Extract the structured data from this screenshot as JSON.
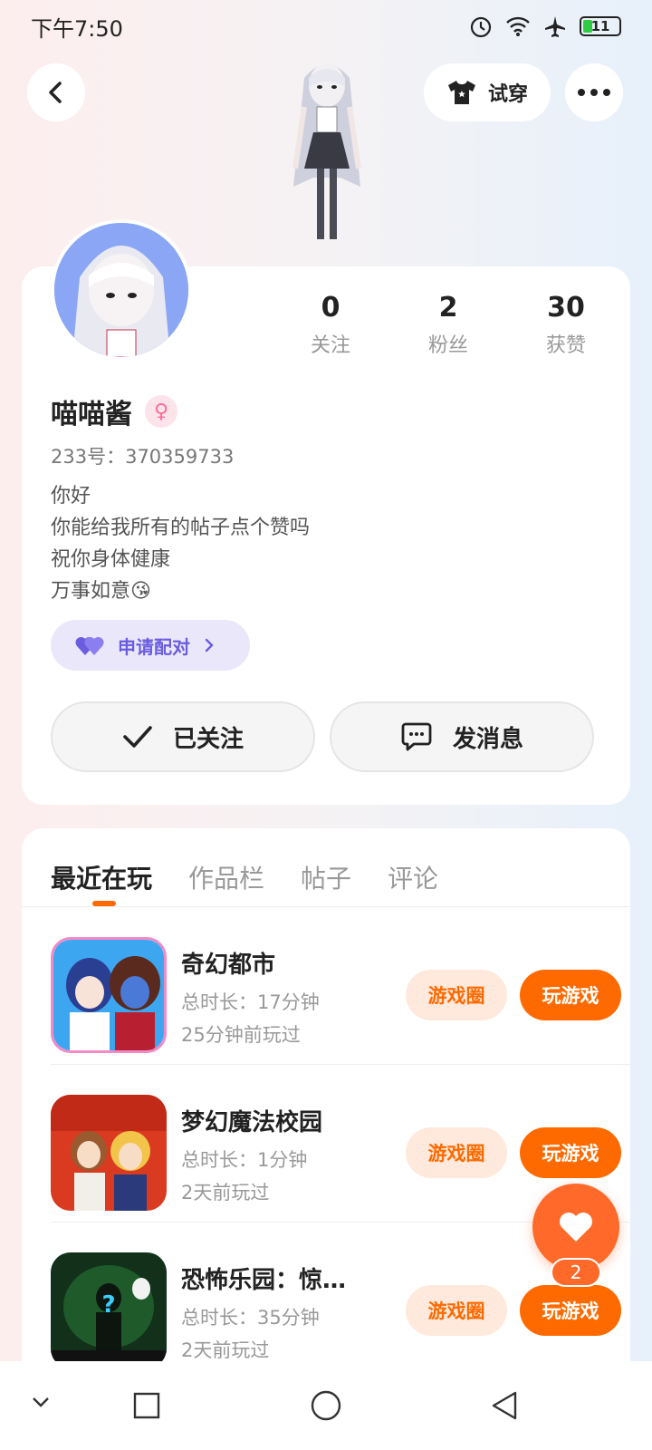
{
  "status_bar": {
    "time": "下午7:50",
    "battery": "11"
  },
  "header": {
    "tryon_label": "试穿"
  },
  "profile": {
    "username": "喵喵酱",
    "uid": "233号：370359733",
    "bio": [
      "你好",
      "你能给我所有的帖子点个赞吗",
      "祝你身体健康",
      "万事如意😘"
    ],
    "stats": [
      {
        "value": "0",
        "label": "关注"
      },
      {
        "value": "2",
        "label": "粉丝"
      },
      {
        "value": "30",
        "label": "获赞"
      }
    ],
    "pair_label": "申请配对",
    "follow_label": "已关注",
    "message_label": "发消息"
  },
  "tabs": [
    "最近在玩",
    "作品栏",
    "帖子",
    "评论"
  ],
  "games": [
    {
      "name": "奇幻都市",
      "duration": "总时长：17分钟",
      "last_played": "25分钟前玩过",
      "circle_label": "游戏圈",
      "play_label": "玩游戏"
    },
    {
      "name": "梦幻魔法校园",
      "duration": "总时长：1分钟",
      "last_played": "2天前玩过",
      "circle_label": "游戏圈",
      "play_label": "玩游戏"
    },
    {
      "name": "恐怖乐园：惊…",
      "duration": "总时长：35分钟",
      "last_played": "2天前玩过",
      "circle_label": "游戏圈",
      "play_label": "玩游戏"
    }
  ],
  "like_fab": {
    "count": "2"
  },
  "colors": {
    "accent": "#ff6a00",
    "pair_purple": "#6b5de0",
    "gender_pink": "#ff6c95"
  },
  "icons": [
    "back-arrow-icon",
    "tshirt-icon",
    "more-dots-icon",
    "female-icon",
    "heart-pair-icon",
    "chevron-right-icon",
    "check-icon",
    "chat-bubble-icon",
    "heart-icon",
    "alarm-icon",
    "wifi-icon",
    "airplane-icon",
    "battery-icon",
    "nav-down-icon",
    "nav-square-icon",
    "nav-circle-icon",
    "nav-back-triangle-icon"
  ]
}
